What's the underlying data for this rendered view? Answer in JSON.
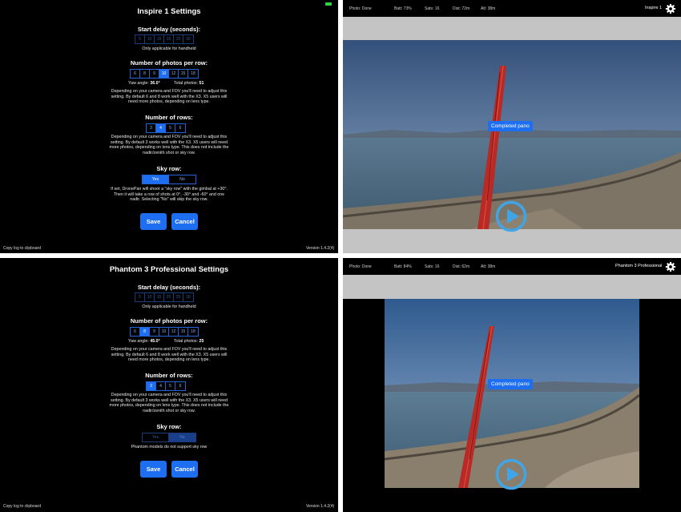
{
  "inspire": {
    "title": "Inspire 1 Settings",
    "start_delay_label": "Start delay (seconds):",
    "start_delay_options": [
      "5",
      "10",
      "15",
      "20",
      "25",
      "30"
    ],
    "handheld_note": "Only applicable for handheld",
    "photos_per_row_label": "Number of photos per row:",
    "photos_per_row_options": [
      "6",
      "8",
      "9",
      "10",
      "12",
      "15",
      "18"
    ],
    "photos_per_row_selected": "10",
    "yaw_label": "Yaw angle:",
    "yaw_value": "36.0°",
    "total_label": "Total photos:",
    "total_value": "51",
    "fov_note_1": "Depending on your camera and FOV you'll need to adjust this",
    "fov_note_2": "setting. By default 6 and 8 work well with the X3. X5 users will",
    "fov_note_3": "need more photos, depending on lens type.",
    "rows_label": "Number of rows:",
    "rows_options": [
      "3",
      "4",
      "5",
      "6"
    ],
    "rows_selected": "4",
    "rows_note_1": "Depending on your camera and FOV you'll need to adjust this",
    "rows_note_2": "setting. By default 3 works well with the X3. X5 users will need",
    "rows_note_3": "more photos, depending on lens type. This does not include the",
    "rows_note_4": "nadir/zenith shot or sky row.",
    "sky_label": "Sky row:",
    "sky_yes": "Yes",
    "sky_no": "No",
    "sky_note_1": "If set, DronePan will shoot a \"sky row\" with the gimbal at +30°.",
    "sky_note_2": "Then it will take a row of shots at 0°, -30° and -60° and one",
    "sky_note_3": "nadir. Selecting \"No\" will skip the sky row.",
    "save": "Save",
    "cancel": "Cancel",
    "copy_log": "Copy log to clipboard",
    "version": "Version 1.4.2(4)"
  },
  "phantom": {
    "title": "Phantom 3 Professional Settings",
    "start_delay_label": "Start delay (seconds):",
    "start_delay_options": [
      "5",
      "10",
      "15",
      "20",
      "25",
      "30"
    ],
    "handheld_note": "Only applicable for handheld",
    "photos_per_row_label": "Number of photos per row:",
    "photos_per_row_options": [
      "6",
      "8",
      "9",
      "10",
      "12",
      "15",
      "18"
    ],
    "photos_per_row_selected": "8",
    "yaw_label": "Yaw angle:",
    "yaw_value": "45.0°",
    "total_label": "Total photos:",
    "total_value": "25",
    "fov_note_1": "Depending on your camera and FOV you'll need to adjust this",
    "fov_note_2": "setting. By default 6 and 8 work well with the X3. X5 users will",
    "fov_note_3": "need more photos, depending on lens type.",
    "rows_label": "Number of rows:",
    "rows_options": [
      "3",
      "4",
      "5",
      "6"
    ],
    "rows_selected": "3",
    "rows_note_1": "Depending on your camera and FOV you'll need to adjust this",
    "rows_note_2": "setting. By default 3 works well with the X3. X5 users will need",
    "rows_note_3": "more photos, depending on lens type. This does not include the",
    "rows_note_4": "nadir/zenith shot or sky row.",
    "sky_label": "Sky row:",
    "sky_yes": "Yes",
    "sky_no": "No",
    "sky_note_1": "Phantom models do not support sky row",
    "save": "Save",
    "cancel": "Cancel",
    "copy_log": "Copy log to clipboard",
    "version": "Version 1.4.2(4)"
  },
  "camera_top": {
    "photo": "Photo: Done",
    "batt": "Batt: 73%",
    "sats": "Sats: 16",
    "dist": "Dist: 72m",
    "alt": "Alt: 38m",
    "drone": "Inspire 1",
    "pano_label": "Completed pano",
    "icons": [
      "gear-icon",
      "play-icon"
    ]
  },
  "camera_bottom": {
    "photo": "Photo: Done",
    "batt": "Batt: 84%",
    "sats": "Sats: 16",
    "dist": "Dist: 62m",
    "alt": "Alt: 38m",
    "drone": "Phantom 3 Professional",
    "pano_label": "Completed pano",
    "icons": [
      "gear-icon",
      "play-icon"
    ]
  },
  "colors": {
    "accent": "#1d6ef0",
    "panel_bg": "#000000",
    "gray_band": "#c4c4c4",
    "battery": "#35d04b",
    "play_ring": "#3ea6e8"
  }
}
